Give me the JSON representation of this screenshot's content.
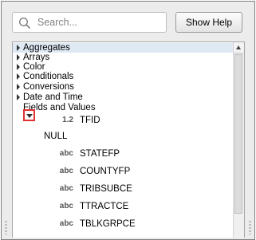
{
  "search": {
    "placeholder": "Search..."
  },
  "toolbar": {
    "help_label": "Show Help"
  },
  "tree": {
    "groups": [
      {
        "label": "Aggregates"
      },
      {
        "label": "Arrays"
      },
      {
        "label": "Color"
      },
      {
        "label": "Conditionals"
      },
      {
        "label": "Conversions"
      },
      {
        "label": "Date and Time"
      },
      {
        "label": "Fields and Values"
      }
    ],
    "fields": [
      {
        "type": "1.2",
        "name": "TFID"
      },
      {
        "type": "",
        "name": "NULL"
      },
      {
        "type": "abc",
        "name": "STATEFP"
      },
      {
        "type": "abc",
        "name": "COUNTYFP"
      },
      {
        "type": "abc",
        "name": "TRIBSUBCE"
      },
      {
        "type": "abc",
        "name": "TTRACTCE"
      },
      {
        "type": "abc",
        "name": "TBLKGRPCE"
      }
    ]
  }
}
